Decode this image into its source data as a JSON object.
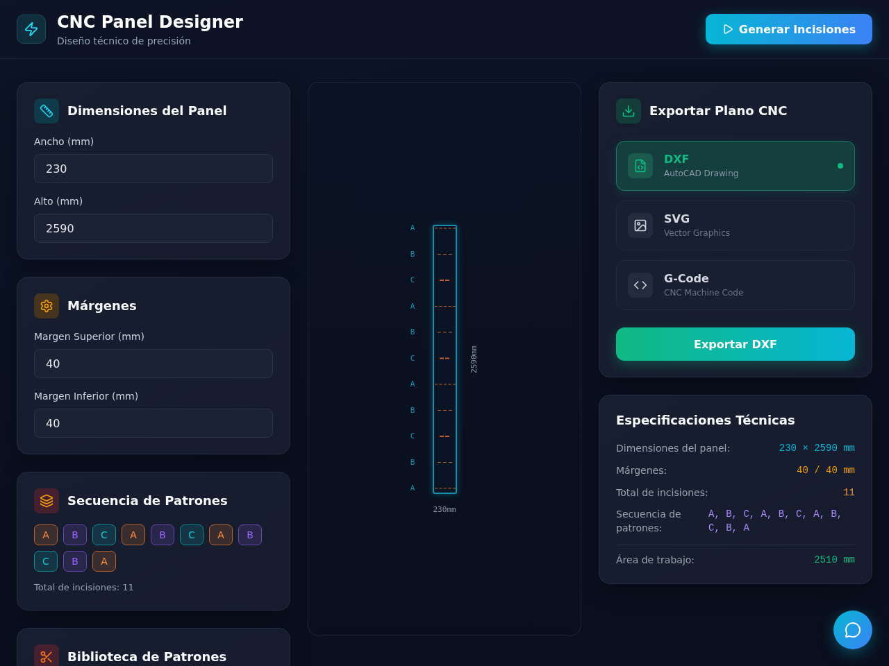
{
  "header": {
    "title": "CNC Panel Designer",
    "subtitle": "Diseño técnico de precisión",
    "action": "Generar Incisiones"
  },
  "dimensions": {
    "title": "Dimensiones del Panel",
    "fields": [
      {
        "label": "Ancho (mm)",
        "value": "230"
      },
      {
        "label": "Alto (mm)",
        "value": "2590"
      }
    ]
  },
  "margins": {
    "title": "Márgenes",
    "fields": [
      {
        "label": "Margen Superior (mm)",
        "value": "40"
      },
      {
        "label": "Margen Inferior (mm)",
        "value": "40"
      }
    ]
  },
  "sequence": {
    "title": "Secuencia de Patrones",
    "chips": [
      {
        "label": "A",
        "color": "#b8642c"
      },
      {
        "label": "B",
        "color": "#6a46b0"
      },
      {
        "label": "C",
        "color": "#0f8a90"
      },
      {
        "label": "A",
        "color": "#b8642c"
      },
      {
        "label": "B",
        "color": "#6a46b0"
      },
      {
        "label": "C",
        "color": "#0f8a90"
      },
      {
        "label": "A",
        "color": "#b8642c"
      },
      {
        "label": "B",
        "color": "#6a46b0"
      },
      {
        "label": "C",
        "color": "#0f8a90"
      },
      {
        "label": "B",
        "color": "#6a46b0"
      },
      {
        "label": "A",
        "color": "#b8642c"
      }
    ],
    "total": "Total de incisiones: 11"
  },
  "library": {
    "title": "Biblioteca de Patrones"
  },
  "preview": {
    "incisions": [
      {
        "label": "A",
        "kind": "wide"
      },
      {
        "label": "B",
        "kind": "medium"
      },
      {
        "label": "C",
        "kind": "short"
      },
      {
        "label": "A",
        "kind": "wide"
      },
      {
        "label": "B",
        "kind": "medium"
      },
      {
        "label": "C",
        "kind": "short"
      },
      {
        "label": "A",
        "kind": "wide"
      },
      {
        "label": "B",
        "kind": "medium"
      },
      {
        "label": "C",
        "kind": "short"
      },
      {
        "label": "B",
        "kind": "medium"
      },
      {
        "label": "A",
        "kind": "wide"
      }
    ],
    "height_label": "2590mm",
    "width_label": "230mm"
  },
  "export": {
    "title": "Exportar Plano CNC",
    "formats": [
      {
        "name": "DXF",
        "description": "AutoCAD Drawing",
        "selected": true
      },
      {
        "name": "SVG",
        "description": "Vector Graphics",
        "selected": false
      },
      {
        "name": "G-Code",
        "description": "CNC Machine Code",
        "selected": false
      }
    ],
    "button": "Exportar DXF"
  },
  "specs": {
    "title": "Especificaciones Técnicas",
    "rows": [
      {
        "kind": "pair",
        "label": "Dimensiones del panel:",
        "value": "230 × 2590 mm",
        "color": "#06b6d4"
      },
      {
        "kind": "pair",
        "label": "Márgenes:",
        "value": "40 / 40 mm",
        "color": "#f59e0b"
      },
      {
        "kind": "pair",
        "label": "Total de incisiones:",
        "value": "11",
        "color": "#fb923c"
      },
      {
        "kind": "list",
        "label": "Secuencia de patrones:",
        "value": "A, B, C, A, B, C, A, B, C, B, A",
        "color": "#a78bfa"
      }
    ],
    "summary": {
      "label": "Área de trabajo:",
      "value": "2510 mm",
      "color": "#10b981"
    }
  }
}
